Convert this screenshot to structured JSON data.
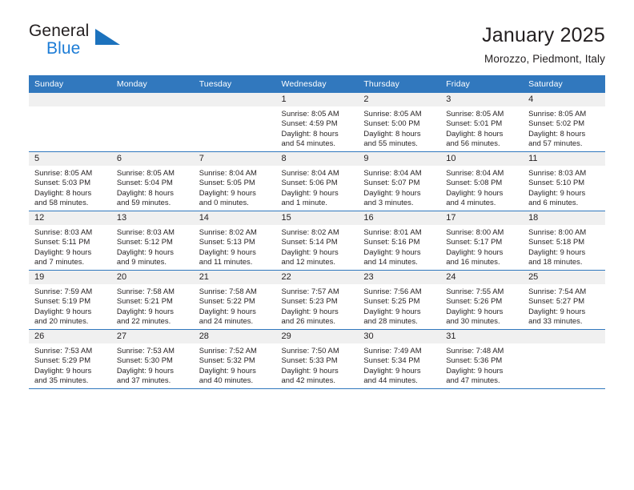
{
  "brand": {
    "name_part1": "General",
    "name_part2": "Blue",
    "triangle_color": "#1c72bd",
    "blue_text_color": "#1c7cd6"
  },
  "header": {
    "title": "January 2025",
    "subtitle": "Morozzo, Piedmont, Italy"
  },
  "calendar": {
    "header_bg": "#3178be",
    "daynum_bg": "#f0f0f0",
    "weekday_headers": [
      "Sunday",
      "Monday",
      "Tuesday",
      "Wednesday",
      "Thursday",
      "Friday",
      "Saturday"
    ],
    "weeks": [
      [
        {
          "day": "",
          "lines": []
        },
        {
          "day": "",
          "lines": []
        },
        {
          "day": "",
          "lines": []
        },
        {
          "day": "1",
          "lines": [
            "Sunrise: 8:05 AM",
            "Sunset: 4:59 PM",
            "Daylight: 8 hours",
            "and 54 minutes."
          ]
        },
        {
          "day": "2",
          "lines": [
            "Sunrise: 8:05 AM",
            "Sunset: 5:00 PM",
            "Daylight: 8 hours",
            "and 55 minutes."
          ]
        },
        {
          "day": "3",
          "lines": [
            "Sunrise: 8:05 AM",
            "Sunset: 5:01 PM",
            "Daylight: 8 hours",
            "and 56 minutes."
          ]
        },
        {
          "day": "4",
          "lines": [
            "Sunrise: 8:05 AM",
            "Sunset: 5:02 PM",
            "Daylight: 8 hours",
            "and 57 minutes."
          ]
        }
      ],
      [
        {
          "day": "5",
          "lines": [
            "Sunrise: 8:05 AM",
            "Sunset: 5:03 PM",
            "Daylight: 8 hours",
            "and 58 minutes."
          ]
        },
        {
          "day": "6",
          "lines": [
            "Sunrise: 8:05 AM",
            "Sunset: 5:04 PM",
            "Daylight: 8 hours",
            "and 59 minutes."
          ]
        },
        {
          "day": "7",
          "lines": [
            "Sunrise: 8:04 AM",
            "Sunset: 5:05 PM",
            "Daylight: 9 hours",
            "and 0 minutes."
          ]
        },
        {
          "day": "8",
          "lines": [
            "Sunrise: 8:04 AM",
            "Sunset: 5:06 PM",
            "Daylight: 9 hours",
            "and 1 minute."
          ]
        },
        {
          "day": "9",
          "lines": [
            "Sunrise: 8:04 AM",
            "Sunset: 5:07 PM",
            "Daylight: 9 hours",
            "and 3 minutes."
          ]
        },
        {
          "day": "10",
          "lines": [
            "Sunrise: 8:04 AM",
            "Sunset: 5:08 PM",
            "Daylight: 9 hours",
            "and 4 minutes."
          ]
        },
        {
          "day": "11",
          "lines": [
            "Sunrise: 8:03 AM",
            "Sunset: 5:10 PM",
            "Daylight: 9 hours",
            "and 6 minutes."
          ]
        }
      ],
      [
        {
          "day": "12",
          "lines": [
            "Sunrise: 8:03 AM",
            "Sunset: 5:11 PM",
            "Daylight: 9 hours",
            "and 7 minutes."
          ]
        },
        {
          "day": "13",
          "lines": [
            "Sunrise: 8:03 AM",
            "Sunset: 5:12 PM",
            "Daylight: 9 hours",
            "and 9 minutes."
          ]
        },
        {
          "day": "14",
          "lines": [
            "Sunrise: 8:02 AM",
            "Sunset: 5:13 PM",
            "Daylight: 9 hours",
            "and 11 minutes."
          ]
        },
        {
          "day": "15",
          "lines": [
            "Sunrise: 8:02 AM",
            "Sunset: 5:14 PM",
            "Daylight: 9 hours",
            "and 12 minutes."
          ]
        },
        {
          "day": "16",
          "lines": [
            "Sunrise: 8:01 AM",
            "Sunset: 5:16 PM",
            "Daylight: 9 hours",
            "and 14 minutes."
          ]
        },
        {
          "day": "17",
          "lines": [
            "Sunrise: 8:00 AM",
            "Sunset: 5:17 PM",
            "Daylight: 9 hours",
            "and 16 minutes."
          ]
        },
        {
          "day": "18",
          "lines": [
            "Sunrise: 8:00 AM",
            "Sunset: 5:18 PM",
            "Daylight: 9 hours",
            "and 18 minutes."
          ]
        }
      ],
      [
        {
          "day": "19",
          "lines": [
            "Sunrise: 7:59 AM",
            "Sunset: 5:19 PM",
            "Daylight: 9 hours",
            "and 20 minutes."
          ]
        },
        {
          "day": "20",
          "lines": [
            "Sunrise: 7:58 AM",
            "Sunset: 5:21 PM",
            "Daylight: 9 hours",
            "and 22 minutes."
          ]
        },
        {
          "day": "21",
          "lines": [
            "Sunrise: 7:58 AM",
            "Sunset: 5:22 PM",
            "Daylight: 9 hours",
            "and 24 minutes."
          ]
        },
        {
          "day": "22",
          "lines": [
            "Sunrise: 7:57 AM",
            "Sunset: 5:23 PM",
            "Daylight: 9 hours",
            "and 26 minutes."
          ]
        },
        {
          "day": "23",
          "lines": [
            "Sunrise: 7:56 AM",
            "Sunset: 5:25 PM",
            "Daylight: 9 hours",
            "and 28 minutes."
          ]
        },
        {
          "day": "24",
          "lines": [
            "Sunrise: 7:55 AM",
            "Sunset: 5:26 PM",
            "Daylight: 9 hours",
            "and 30 minutes."
          ]
        },
        {
          "day": "25",
          "lines": [
            "Sunrise: 7:54 AM",
            "Sunset: 5:27 PM",
            "Daylight: 9 hours",
            "and 33 minutes."
          ]
        }
      ],
      [
        {
          "day": "26",
          "lines": [
            "Sunrise: 7:53 AM",
            "Sunset: 5:29 PM",
            "Daylight: 9 hours",
            "and 35 minutes."
          ]
        },
        {
          "day": "27",
          "lines": [
            "Sunrise: 7:53 AM",
            "Sunset: 5:30 PM",
            "Daylight: 9 hours",
            "and 37 minutes."
          ]
        },
        {
          "day": "28",
          "lines": [
            "Sunrise: 7:52 AM",
            "Sunset: 5:32 PM",
            "Daylight: 9 hours",
            "and 40 minutes."
          ]
        },
        {
          "day": "29",
          "lines": [
            "Sunrise: 7:50 AM",
            "Sunset: 5:33 PM",
            "Daylight: 9 hours",
            "and 42 minutes."
          ]
        },
        {
          "day": "30",
          "lines": [
            "Sunrise: 7:49 AM",
            "Sunset: 5:34 PM",
            "Daylight: 9 hours",
            "and 44 minutes."
          ]
        },
        {
          "day": "31",
          "lines": [
            "Sunrise: 7:48 AM",
            "Sunset: 5:36 PM",
            "Daylight: 9 hours",
            "and 47 minutes."
          ]
        },
        {
          "day": "",
          "lines": []
        }
      ]
    ]
  }
}
